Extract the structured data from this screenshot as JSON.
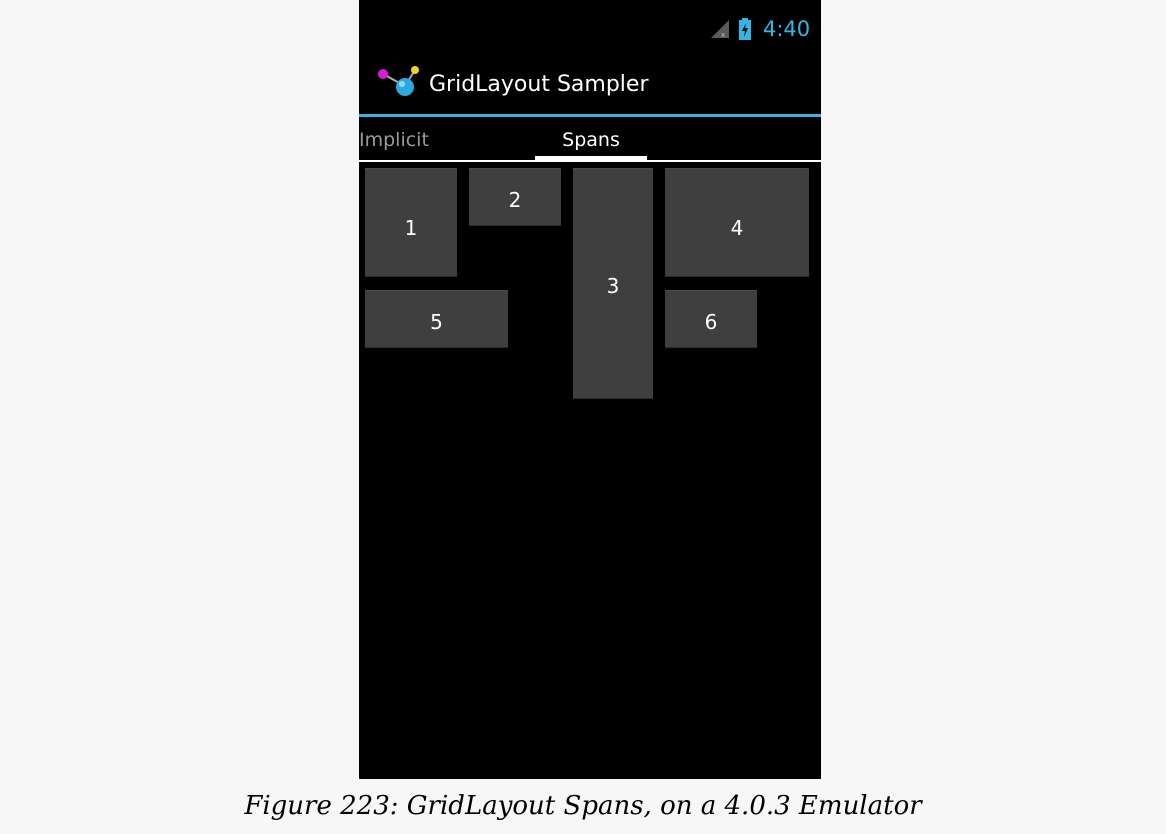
{
  "status_bar": {
    "time": "4:40",
    "signal_icon": "signal-icon",
    "battery_icon": "battery-charging-icon",
    "accent_color": "#33b5e5"
  },
  "action_bar": {
    "app_icon": "app-icon",
    "title": "GridLayout Sampler"
  },
  "tabs": [
    {
      "label": "Implicit",
      "selected": false
    },
    {
      "label": "Spans",
      "selected": true
    }
  ],
  "grid": {
    "buttons": [
      {
        "label": "1"
      },
      {
        "label": "2"
      },
      {
        "label": "3"
      },
      {
        "label": "4"
      },
      {
        "label": "5"
      },
      {
        "label": "6"
      }
    ]
  },
  "caption": "Figure 223: GridLayout Spans, on a 4.0.3 Emulator"
}
